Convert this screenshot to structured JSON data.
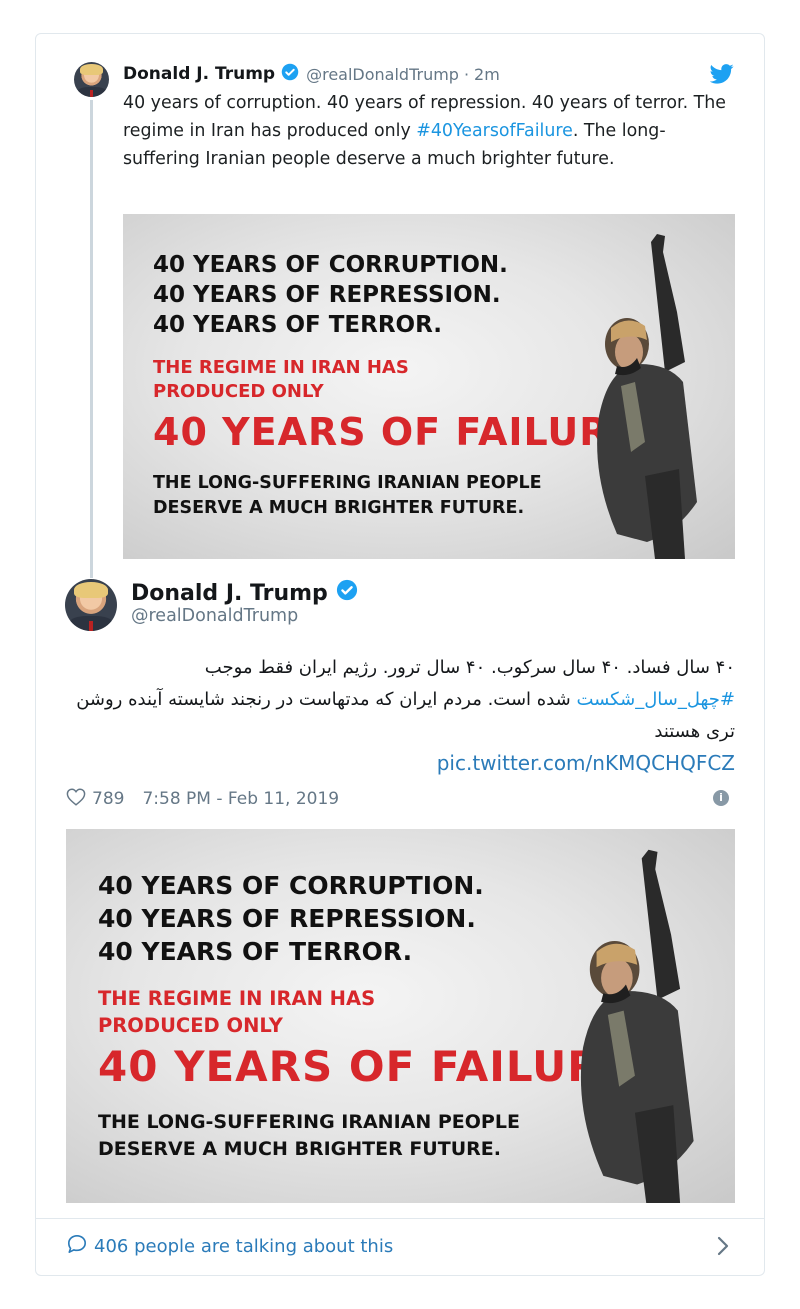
{
  "quoted_tweet": {
    "name": "Donald J. Trump",
    "handle": "@realDonaldTrump",
    "separator": "·",
    "time": "2m",
    "text_before": "40 years of corruption. 40 years of repression. 40 years of terror. The regime in Iran has produced only ",
    "hashtag": "#40YearsofFailure",
    "text_after": ". The long-suffering Iranian people deserve a much brighter future."
  },
  "poster": {
    "line1": "40 YEARS OF CORRUPTION.",
    "line2": "40 YEARS OF REPRESSION.",
    "line3": "40 YEARS OF TERROR.",
    "red_line1": "THE REGIME IN IRAN HAS",
    "red_line2": "PRODUCED ONLY",
    "big_line": "40 YEARS OF FAILURE.",
    "bottom_line1": "THE LONG-SUFFERING IRANIAN PEOPLE",
    "bottom_line2": "DESERVE A MUCH BRIGHTER FUTURE."
  },
  "main_tweet": {
    "name": "Donald J. Trump",
    "handle": "@realDonaldTrump",
    "text_before": "۴۰ سال فساد. ۴۰ سال سرکوب. ۴۰ سال ترور. رژیم ایران فقط موجب ",
    "hashtag": "#چهل_سال_شکست",
    "text_after": " شده است. مردم ایران که مدتهاست در رنجند شایسته آینده روشن تری هستند",
    "link": "pic.twitter.com/nKMQCHQFCZ",
    "likes": "789",
    "timestamp": "7:58 PM - Feb 11, 2019",
    "info_glyph": "i"
  },
  "footer": {
    "talking": "406 people are talking about this"
  },
  "colors": {
    "link_blue": "#1b95e0",
    "footer_blue": "#2b7bb9",
    "meta_gray": "#657786",
    "poster_red": "#d7272b",
    "verified_blue": "#1da1f2"
  },
  "icons": {
    "verified": "verified-badge-icon",
    "bird": "twitter-bird-icon",
    "heart": "heart-icon",
    "info": "info-icon",
    "comment": "comment-bubble-icon",
    "chevron": "chevron-right-icon"
  }
}
